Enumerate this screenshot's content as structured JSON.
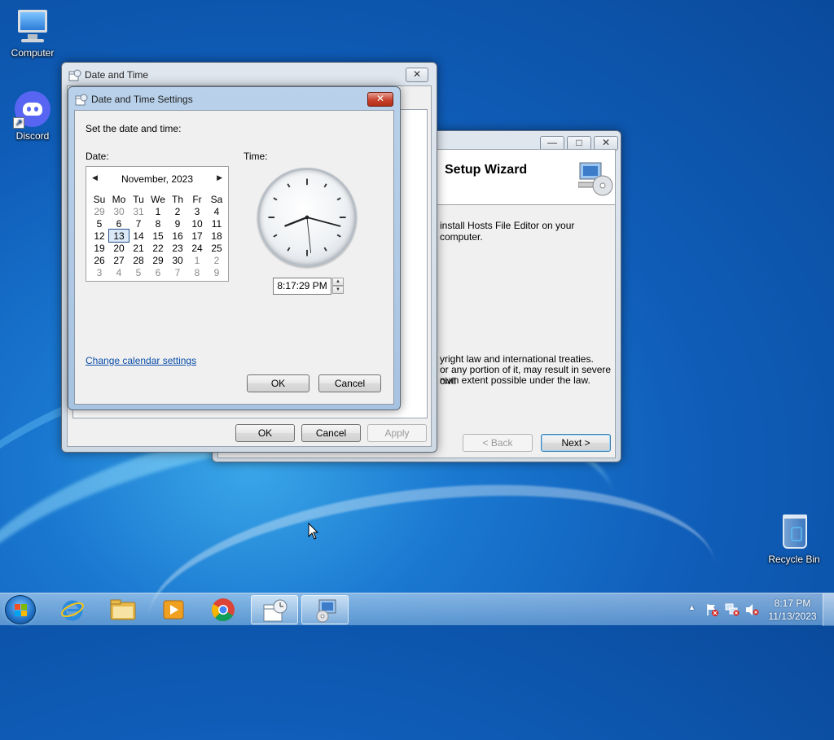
{
  "desktop": {
    "icons": [
      {
        "label": "Computer"
      },
      {
        "label": "Discord"
      },
      {
        "label": "Recycle Bin"
      }
    ]
  },
  "wizard": {
    "title_partial": "Setup Wizard",
    "intro_text": "install Hosts File Editor on your computer.",
    "copyright_line1": "yright law and international treaties.",
    "copyright_line2": "or any portion of it, may result in severe civil",
    "copyright_line3": "num extent possible under the law.",
    "back_label": "< Back",
    "next_label": "Next >",
    "minimize_glyph": "—",
    "maximize_glyph": "□",
    "close_glyph": "✕"
  },
  "date_time_dialog": {
    "title": "Date and Time",
    "close_glyph": "✕",
    "ok_label": "OK",
    "cancel_label": "Cancel",
    "apply_label": "Apply"
  },
  "settings_dialog": {
    "title": "Date and Time Settings",
    "close_glyph": "✕",
    "instruction": "Set the date and time:",
    "date_label": "Date:",
    "time_label": "Time:",
    "calendar": {
      "month_year": "November, 2023",
      "prev_glyph": "◀",
      "next_glyph": "▶",
      "weekdays": [
        "Su",
        "Mo",
        "Tu",
        "We",
        "Th",
        "Fr",
        "Sa"
      ],
      "weeks": [
        [
          "29",
          "30",
          "31",
          "1",
          "2",
          "3",
          "4"
        ],
        [
          "5",
          "6",
          "7",
          "8",
          "9",
          "10",
          "11"
        ],
        [
          "12",
          "13",
          "14",
          "15",
          "16",
          "17",
          "18"
        ],
        [
          "19",
          "20",
          "21",
          "22",
          "23",
          "24",
          "25"
        ],
        [
          "26",
          "27",
          "28",
          "29",
          "30",
          "1",
          "2"
        ],
        [
          "3",
          "4",
          "5",
          "6",
          "7",
          "8",
          "9"
        ]
      ],
      "selected_day": "13"
    },
    "clock": {
      "hours": 8,
      "minutes": 17,
      "seconds": 29
    },
    "time_value": "8:17:29 PM",
    "change_calendar_link": "Change calendar settings",
    "ok_label": "OK",
    "cancel_label": "Cancel"
  },
  "taskbar": {
    "clock_time": "8:17 PM",
    "clock_date": "11/13/2023",
    "tray_arrow": "▲"
  }
}
